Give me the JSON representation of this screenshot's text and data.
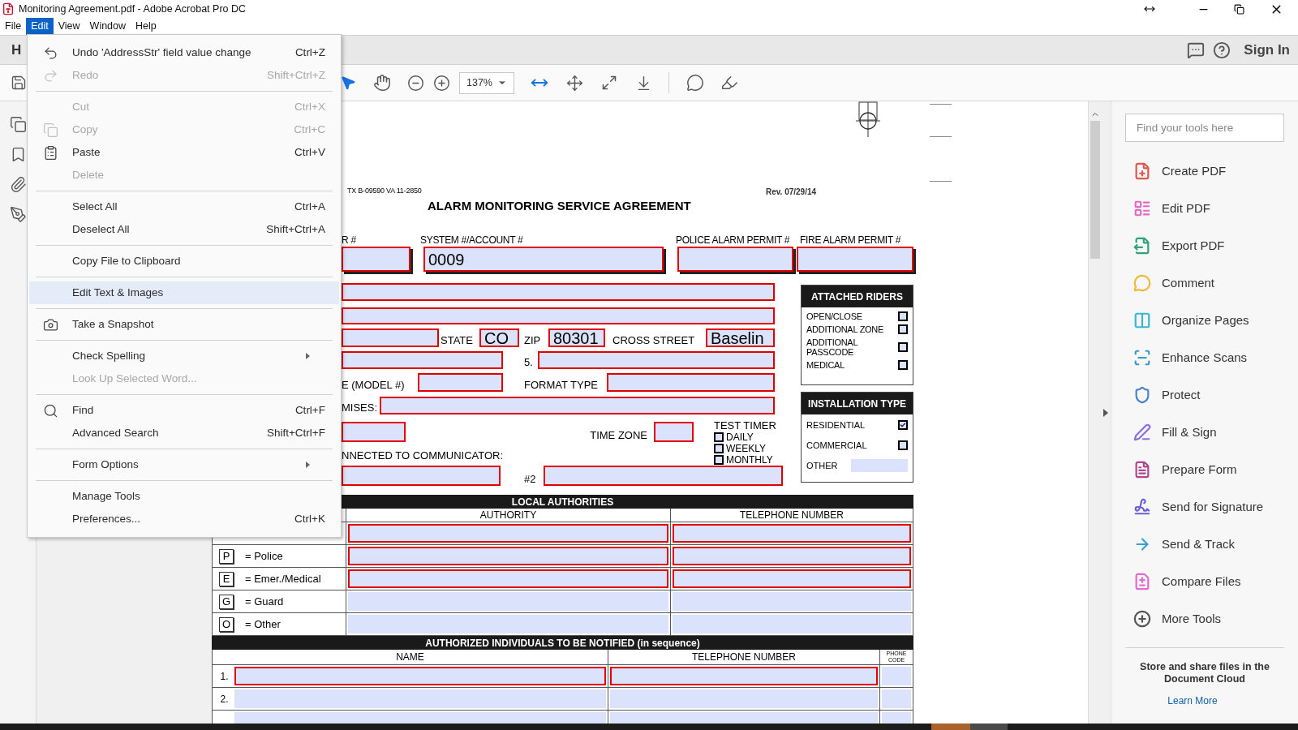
{
  "window": {
    "title": "Monitoring Agreement.pdf - Adobe Acrobat Pro DC"
  },
  "menu_bar": [
    {
      "label": "File",
      "selected": false
    },
    {
      "label": "Edit",
      "selected": true
    },
    {
      "label": "View",
      "selected": false
    },
    {
      "label": "Window",
      "selected": false
    },
    {
      "label": "Help",
      "selected": false
    }
  ],
  "home_tab": {
    "label": "H"
  },
  "sign_in": "Sign In",
  "toolbar": {
    "zoom": "137%"
  },
  "edit_menu": [
    {
      "kind": "item",
      "label": "Undo 'AddressStr' field value change",
      "shortcut": "Ctrl+Z",
      "disabled": false,
      "selected": false,
      "submenu": false
    },
    {
      "kind": "item",
      "label": "Redo",
      "shortcut": "Shift+Ctrl+Z",
      "disabled": true,
      "selected": false,
      "submenu": false
    },
    {
      "kind": "separator"
    },
    {
      "kind": "item",
      "label": "Cut",
      "shortcut": "Ctrl+X",
      "disabled": true,
      "selected": false,
      "submenu": false
    },
    {
      "kind": "item",
      "label": "Copy",
      "shortcut": "Ctrl+C",
      "disabled": true,
      "selected": false,
      "submenu": false
    },
    {
      "kind": "item",
      "label": "Paste",
      "shortcut": "Ctrl+V",
      "disabled": false,
      "selected": false,
      "submenu": false
    },
    {
      "kind": "item",
      "label": "Delete",
      "disabled": true,
      "selected": false,
      "submenu": false
    },
    {
      "kind": "separator"
    },
    {
      "kind": "item",
      "label": "Select All",
      "shortcut": "Ctrl+A",
      "disabled": false,
      "selected": false,
      "submenu": false
    },
    {
      "kind": "item",
      "label": "Deselect All",
      "shortcut": "Shift+Ctrl+A",
      "disabled": false,
      "selected": false,
      "submenu": false
    },
    {
      "kind": "separator"
    },
    {
      "kind": "item",
      "label": "Copy File to Clipboard",
      "disabled": false,
      "selected": false,
      "submenu": false
    },
    {
      "kind": "separator"
    },
    {
      "kind": "item",
      "label": "Edit Text & Images",
      "disabled": false,
      "selected": true,
      "submenu": false
    },
    {
      "kind": "separator"
    },
    {
      "kind": "item",
      "label": "Take a Snapshot",
      "disabled": false,
      "selected": false,
      "submenu": false
    },
    {
      "kind": "separator"
    },
    {
      "kind": "item",
      "label": "Check Spelling",
      "disabled": false,
      "selected": false,
      "submenu": true
    },
    {
      "kind": "item",
      "label": "Look Up Selected Word...",
      "disabled": true,
      "selected": false,
      "submenu": false
    },
    {
      "kind": "separator"
    },
    {
      "kind": "item",
      "label": "Find",
      "shortcut": "Ctrl+F",
      "disabled": false,
      "selected": false,
      "submenu": false
    },
    {
      "kind": "item",
      "label": "Advanced Search",
      "shortcut": "Shift+Ctrl+F",
      "disabled": false,
      "selected": false,
      "submenu": false
    },
    {
      "kind": "separator"
    },
    {
      "kind": "item",
      "label": "Form Options",
      "disabled": false,
      "selected": false,
      "submenu": true
    },
    {
      "kind": "separator"
    },
    {
      "kind": "item",
      "label": "Manage Tools",
      "disabled": false,
      "selected": false,
      "submenu": false
    },
    {
      "kind": "item",
      "label": "Preferences...",
      "shortcut": "Ctrl+K",
      "disabled": false,
      "selected": false,
      "submenu": false
    }
  ],
  "document": {
    "form_code": "TX B-09590 VA 11-2850",
    "title": "ALARM MONITORING SERVICE AGREEMENT",
    "revision": "Rev. 07/29/14",
    "fields_highlighted": true,
    "top_labels": [
      "R #",
      "SYSTEM #/ACCOUNT #",
      "POLICE ALARM PERMIT #",
      "FIRE ALARM PERMIT #"
    ],
    "account_value": "0009",
    "state_label": "STATE",
    "state_value": "CO",
    "zip_label": "ZIP",
    "zip_value": "80301",
    "cross_street_label": "CROSS STREET",
    "cross_street_value": "Baselin",
    "line5_label": "5.",
    "model_label": "E (MODEL #)",
    "format_label": "FORMAT TYPE",
    "premises_label": "MISES:",
    "time_zone_label": "TIME ZONE",
    "communicator_label": "NNECTED TO COMMUNICATOR:",
    "second_label": "#2",
    "test_timer": {
      "title": "TEST TIMER",
      "options": [
        {
          "label": "DAILY",
          "checked": false
        },
        {
          "label": "WEEKLY",
          "checked": false
        },
        {
          "label": "MONTHLY",
          "checked": false
        }
      ]
    },
    "attached_riders": {
      "title": "ATTACHED RIDERS",
      "items": [
        {
          "label": "OPEN/CLOSE",
          "checked": false
        },
        {
          "label": "ADDITIONAL ZONE",
          "checked": false
        },
        {
          "label": "ADDITIONAL PASSCODE",
          "checked": false
        },
        {
          "label": "MEDICAL",
          "checked": false
        }
      ]
    },
    "installation_type": {
      "title": "INSTALLATION TYPE",
      "items": [
        {
          "kind": "checkbox",
          "label": "RESIDENTIAL",
          "checked": true
        },
        {
          "kind": "checkbox",
          "label": "COMMERCIAL",
          "checked": false
        },
        {
          "kind": "field",
          "label": "OTHER"
        }
      ]
    },
    "local_authorities": {
      "title": "LOCAL AUTHORITIES",
      "columns": [
        "AUTHORITY",
        "TELEPHONE NUMBER"
      ],
      "rows": [
        {
          "required": true
        },
        {
          "code": "P",
          "label": "= Police",
          "required": true
        },
        {
          "code": "E",
          "label": "= Emer./Medical",
          "required": true
        },
        {
          "code": "G",
          "label": "= Guard",
          "required": false
        },
        {
          "code": "O",
          "label": "= Other",
          "required": false
        }
      ]
    },
    "authorized": {
      "title": "AUTHORIZED INDIVIDUALS TO BE NOTIFIED (in sequence)",
      "columns": [
        "NAME",
        "TELEPHONE NUMBER",
        "PHONE CODE"
      ],
      "rows": [
        {
          "number": "1.",
          "required": true
        },
        {
          "number": "2.",
          "required": false
        },
        {
          "required": false
        }
      ]
    }
  },
  "tools_panel": {
    "search_placeholder": "Find your tools here",
    "tools": [
      {
        "label": "Create PDF",
        "color": "#e0584e"
      },
      {
        "label": "Edit PDF",
        "color": "#e06bc4"
      },
      {
        "label": "Export PDF",
        "color": "#2ea37c"
      },
      {
        "label": "Comment",
        "color": "#f0b93a"
      },
      {
        "label": "Organize Pages",
        "color": "#3bb7d6"
      },
      {
        "label": "Enhance Scans",
        "color": "#3a96d4"
      },
      {
        "label": "Protect",
        "color": "#4a86c5"
      },
      {
        "label": "Fill & Sign",
        "color": "#8a6ee0"
      },
      {
        "label": "Prepare Form",
        "color": "#b0478f"
      },
      {
        "label": "Send for Signature",
        "color": "#6b5fd8"
      },
      {
        "label": "Send & Track",
        "color": "#3a9fd6"
      },
      {
        "label": "Compare Files",
        "color": "#e66bcd"
      },
      {
        "label": "More Tools",
        "color": "#555555"
      }
    ],
    "cloud_text": "Store and share files in the Document Cloud",
    "link": "Learn More"
  }
}
